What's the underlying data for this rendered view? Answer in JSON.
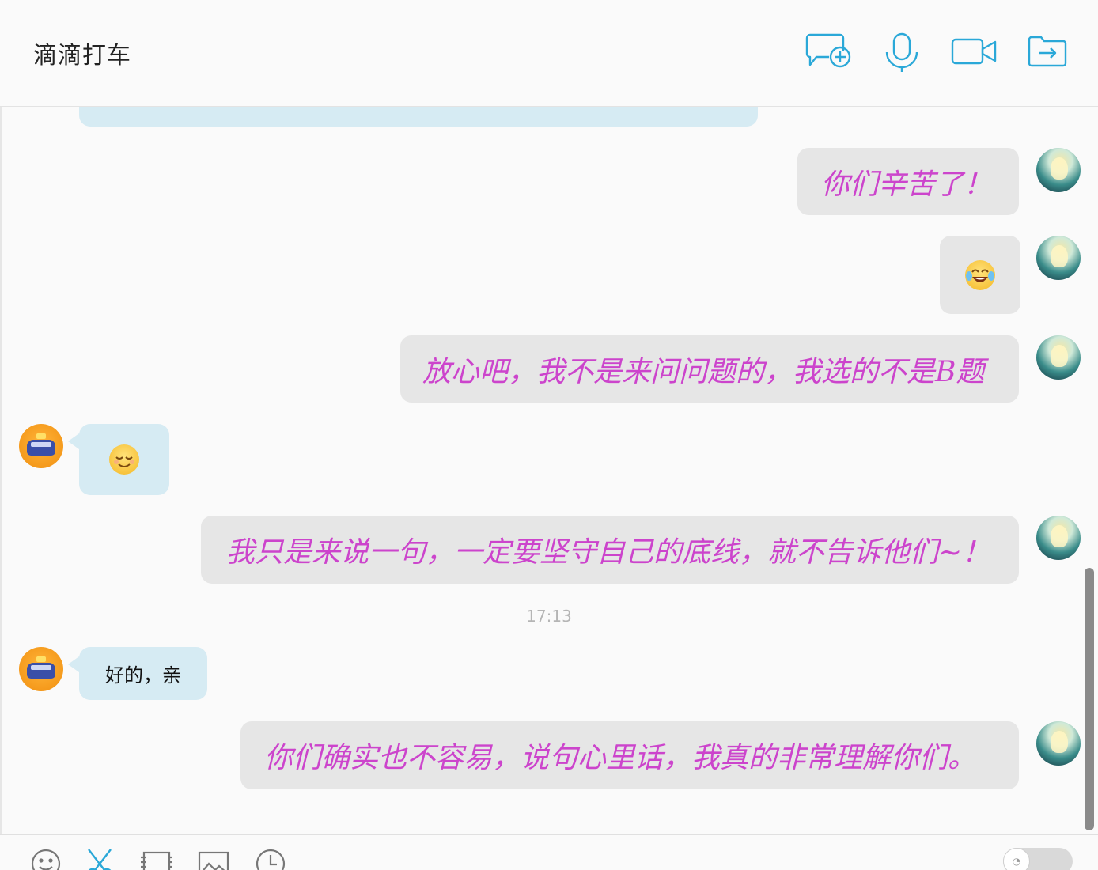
{
  "header": {
    "title": "滴滴打车"
  },
  "messages": [
    {
      "from": "user",
      "text": "你们辛苦了！"
    },
    {
      "from": "user",
      "emoji": "tears-of-joy-emoji"
    },
    {
      "from": "user",
      "text": "放心吧，我不是来问问题的，我选的不是B题"
    },
    {
      "from": "contact",
      "emoji": "relieved-face-emoji"
    },
    {
      "from": "user",
      "text": "我只是来说一句，一定要坚守自己的底线，就不告诉他们~！"
    },
    {
      "from": "contact",
      "text": "好的，亲"
    },
    {
      "from": "user",
      "text": "你们确实也不容易，说句心里话，我真的非常理解你们。"
    }
  ],
  "timestamp": "17:13",
  "colors": {
    "outgoing_bubble": "#e6e6e6",
    "incoming_bubble": "#d6ebf3",
    "outgoing_text": "#cc44cc",
    "icon_accent": "#2aa8d8"
  },
  "icons": {
    "header": [
      "new-chat-icon",
      "microphone-icon",
      "video-camera-icon",
      "share-icon"
    ],
    "toolbar": [
      "emoji-icon",
      "scissors-icon",
      "screen-capture-icon",
      "image-icon",
      "history-clock-icon",
      "voice-toggle"
    ]
  }
}
